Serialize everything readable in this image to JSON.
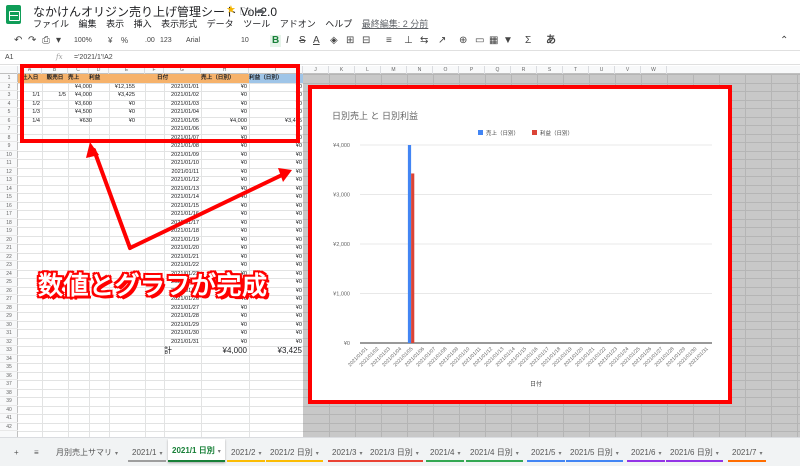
{
  "header": {
    "title": "なかけんオリジン売り上げ管理シート Vol.2.0",
    "star": "★",
    "folder": "🗀",
    "cloud": "☁",
    "menu": [
      "ファイル",
      "編集",
      "表示",
      "挿入",
      "表示形式",
      "データ",
      "ツール",
      "アドオン",
      "ヘルプ"
    ],
    "last_edit": "最終編集: 2 分前"
  },
  "toolbar": {
    "undo": "↶",
    "redo": "↷",
    "print": "⎙",
    "paint": "▾",
    "zoom": "100%",
    "currency": "¥",
    "percent": "%",
    ".0": ".0",
    "_00": ".00",
    "fmt": "123",
    "font": "Arial",
    "size": "10",
    "bold": "B",
    "italic": "I",
    "strike": "S",
    "textcolor": "A",
    "fill": "◈",
    "borders": "⊞",
    "merge": "⊟",
    "align": "≡",
    "valign": "⊥",
    "wrap": "⇆",
    "rotate": "↗",
    "link": "⊕",
    "comment": "▭",
    "chart": "▦",
    "filter": "▼",
    "functions": "Σ",
    "input": "あ",
    "collapse": "⌃"
  },
  "formula": {
    "ref": "A1",
    "fx": "fx",
    "value": "='2021/1'!A2"
  },
  "columns": [
    "A",
    "B",
    "C",
    "D",
    "E",
    "F",
    "G",
    "H",
    "I",
    "J",
    "K",
    "L",
    "M",
    "N",
    "O",
    "P",
    "Q",
    "R",
    "S",
    "T",
    "U",
    "V",
    "W"
  ],
  "rows": [
    "1",
    "2",
    "3",
    "4",
    "5",
    "6",
    "7",
    "8",
    "9",
    "10",
    "11",
    "12",
    "13",
    "14",
    "15",
    "16",
    "17",
    "18",
    "19",
    "20",
    "21",
    "22",
    "23",
    "24",
    "25",
    "26",
    "27",
    "28",
    "29",
    "30",
    "31",
    "32",
    "33",
    "34",
    "35",
    "36",
    "37",
    "38",
    "39",
    "40",
    "41",
    "42"
  ],
  "table_left": {
    "headers": [
      "仕入日",
      "販売日",
      "売上",
      "利益"
    ],
    "rows": [
      [
        "",
        "",
        "¥4,000",
        "¥12,155"
      ],
      [
        "1/1",
        "1/5",
        "¥4,000",
        "¥3,425"
      ],
      [
        "1/2",
        "",
        "¥3,600",
        "¥0"
      ],
      [
        "1/3",
        "",
        "¥4,500",
        "¥0"
      ],
      [
        "1/4",
        "",
        "¥630",
        "¥0"
      ]
    ]
  },
  "table_right": {
    "headers": [
      "日付",
      "売上（日別）",
      "利益（日別）"
    ],
    "rows": [
      [
        "2021/01/01",
        "¥0",
        "¥0"
      ],
      [
        "2021/01/02",
        "¥0",
        "¥0"
      ],
      [
        "2021/01/03",
        "¥0",
        "¥0"
      ],
      [
        "2021/01/04",
        "¥0",
        "¥0"
      ],
      [
        "2021/01/05",
        "¥4,000",
        "¥3,425"
      ],
      [
        "2021/01/06",
        "¥0",
        "¥0"
      ],
      [
        "2021/01/07",
        "¥0",
        "¥0"
      ],
      [
        "2021/01/08",
        "¥0",
        "¥0"
      ],
      [
        "2021/01/09",
        "¥0",
        "¥0"
      ],
      [
        "2021/01/10",
        "¥0",
        "¥0"
      ],
      [
        "2021/01/11",
        "¥0",
        "¥0"
      ],
      [
        "2021/01/12",
        "¥0",
        "¥0"
      ],
      [
        "2021/01/13",
        "¥0",
        "¥0"
      ],
      [
        "2021/01/14",
        "¥0",
        "¥0"
      ],
      [
        "2021/01/15",
        "¥0",
        "¥0"
      ],
      [
        "2021/01/16",
        "¥0",
        "¥0"
      ],
      [
        "2021/01/17",
        "¥0",
        "¥0"
      ],
      [
        "2021/01/18",
        "¥0",
        "¥0"
      ],
      [
        "2021/01/19",
        "¥0",
        "¥0"
      ],
      [
        "2021/01/20",
        "¥0",
        "¥0"
      ],
      [
        "2021/01/21",
        "¥0",
        "¥0"
      ],
      [
        "2021/01/22",
        "¥0",
        "¥0"
      ],
      [
        "2021/01/23",
        "¥0",
        "¥0"
      ],
      [
        "2021/01/24",
        "¥0",
        "¥0"
      ],
      [
        "2021/01/25",
        "¥0",
        "¥0"
      ],
      [
        "2021/01/26",
        "¥0",
        "¥0"
      ],
      [
        "2021/01/27",
        "¥0",
        "¥0"
      ],
      [
        "2021/01/28",
        "¥0",
        "¥0"
      ],
      [
        "2021/01/29",
        "¥0",
        "¥0"
      ],
      [
        "2021/01/30",
        "¥0",
        "¥0"
      ],
      [
        "2021/01/31",
        "¥0",
        "¥0"
      ]
    ],
    "total_label": "計",
    "total_sales": "¥4,000",
    "total_profit": "¥3,425"
  },
  "colors": {
    "header_orange": "#f6b26b",
    "header_blue": "#9fc5e8",
    "accent_red": "#ff0000",
    "sales": "#4285f4",
    "profit": "#db4437"
  },
  "annotation": {
    "text": "数値とグラフが完成"
  },
  "chart_data": {
    "type": "bar",
    "title": "日別売上 と 日別利益",
    "categories": [
      "2021/01/01",
      "2021/01/02",
      "2021/01/03",
      "2021/01/04",
      "2021/01/05",
      "2021/01/06",
      "2021/01/07",
      "2021/01/08",
      "2021/01/09",
      "2021/01/10",
      "2021/01/11",
      "2021/01/12",
      "2021/01/13",
      "2021/01/14",
      "2021/01/15",
      "2021/01/16",
      "2021/01/17",
      "2021/01/18",
      "2021/01/19",
      "2021/01/20",
      "2021/01/21",
      "2021/01/22",
      "2021/01/23",
      "2021/01/24",
      "2021/01/25",
      "2021/01/26",
      "2021/01/27",
      "2021/01/28",
      "2021/01/29",
      "2021/01/30",
      "2021/01/31"
    ],
    "series": [
      {
        "name": "売上（日別）",
        "values": [
          0,
          0,
          0,
          0,
          4000,
          0,
          0,
          0,
          0,
          0,
          0,
          0,
          0,
          0,
          0,
          0,
          0,
          0,
          0,
          0,
          0,
          0,
          0,
          0,
          0,
          0,
          0,
          0,
          0,
          0,
          0
        ]
      },
      {
        "name": "利益（日別）",
        "values": [
          0,
          0,
          0,
          0,
          3425,
          0,
          0,
          0,
          0,
          0,
          0,
          0,
          0,
          0,
          0,
          0,
          0,
          0,
          0,
          0,
          0,
          0,
          0,
          0,
          0,
          0,
          0,
          0,
          0,
          0,
          0
        ]
      }
    ],
    "y_ticks": [
      "¥0",
      "¥1,000",
      "¥2,000",
      "¥3,000",
      "¥4,000"
    ],
    "ylim": [
      0,
      4000
    ],
    "xlabel": "日付",
    "ylabel": "",
    "legend": "top",
    "grid": true
  },
  "tabs": [
    {
      "label": "+"
    },
    {
      "label": "≡"
    },
    {
      "label": "月別売上サマリ"
    },
    {
      "label": "2021/1"
    },
    {
      "label": "2021/1 日別"
    },
    {
      "label": "2021/2"
    },
    {
      "label": "2021/2 日別"
    },
    {
      "label": "2021/3"
    },
    {
      "label": "2021/3 日別"
    },
    {
      "label": "2021/4"
    },
    {
      "label": "2021/4 日別"
    },
    {
      "label": "2021/5"
    },
    {
      "label": "2021/5 日別"
    },
    {
      "label": "2021/6"
    },
    {
      "label": "2021/6 日別"
    },
    {
      "label": "2021/7"
    }
  ]
}
